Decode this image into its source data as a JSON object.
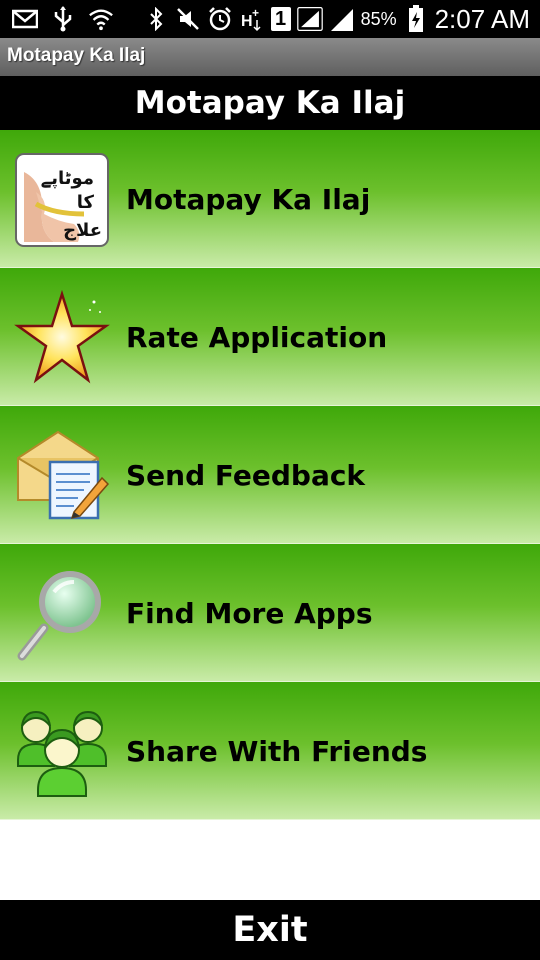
{
  "status_bar": {
    "battery_percent": "85%",
    "time": "2:07 AM",
    "network_badge": "1",
    "icons": [
      "email-icon",
      "usb-icon",
      "wifi-icon",
      "bluetooth-icon",
      "mute-icon",
      "alarm-icon",
      "hplus-icon",
      "sim-icon",
      "signal-icon",
      "signal-icon-2",
      "battery-charging-icon"
    ]
  },
  "app_bar": {
    "title": "Motapay Ka Ilaj"
  },
  "header": {
    "title": "Motapay Ka Ilaj"
  },
  "menu": {
    "items": [
      {
        "label": "Motapay Ka Ilaj",
        "icon": "book-cover-icon",
        "icon_text": "موٹاپے کا علاج"
      },
      {
        "label": "Rate Application",
        "icon": "star-icon"
      },
      {
        "label": "Send Feedback",
        "icon": "feedback-envelope-icon"
      },
      {
        "label": "Find More Apps",
        "icon": "magnifier-icon"
      },
      {
        "label": "Share With Friends",
        "icon": "friends-icon"
      }
    ]
  },
  "footer": {
    "exit_label": "Exit"
  },
  "colors": {
    "menu_green": "#3fa80a",
    "menu_light": "#c9eba8",
    "bar_black": "#000000"
  }
}
